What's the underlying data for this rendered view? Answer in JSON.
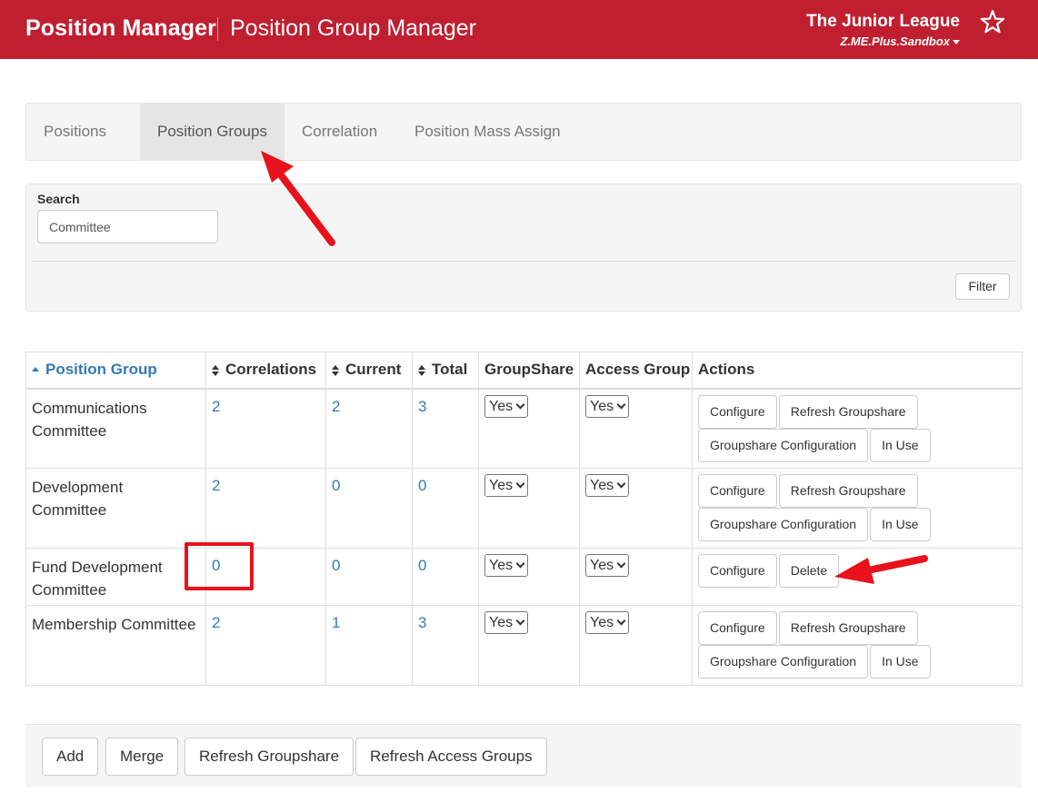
{
  "header": {
    "app_title": "Position Manager",
    "page_title": "Position Group Manager",
    "org_name": "The Junior League",
    "org_sub": "Z.ME.Plus.Sandbox",
    "brand_color": "#c01f30"
  },
  "tabs": [
    {
      "label": "Positions",
      "active": false
    },
    {
      "label": "Position Groups",
      "active": true
    },
    {
      "label": "Correlation",
      "active": false
    },
    {
      "label": "Position Mass Assign",
      "active": false
    }
  ],
  "search": {
    "label": "Search",
    "value": "Committee",
    "filter_label": "Filter"
  },
  "table": {
    "columns": [
      "Position Group",
      "Correlations",
      "Current",
      "Total",
      "GroupShare",
      "Access Group",
      "Actions"
    ],
    "rows": [
      {
        "name": "Communications Committee",
        "correlations": "2",
        "current": "2",
        "total": "3",
        "groupshare": "Yes",
        "access_group": "Yes",
        "actions": [
          "Configure",
          "Refresh Groupshare",
          "Groupshare Configuration",
          "In Use"
        ]
      },
      {
        "name": "Development Committee",
        "correlations": "2",
        "current": "0",
        "total": "0",
        "groupshare": "Yes",
        "access_group": "Yes",
        "actions": [
          "Configure",
          "Refresh Groupshare",
          "Groupshare Configuration",
          "In Use"
        ]
      },
      {
        "name": "Fund Development Committee",
        "correlations": "0",
        "current": "0",
        "total": "0",
        "groupshare": "Yes",
        "access_group": "Yes",
        "actions": [
          "Configure",
          "Delete"
        ]
      },
      {
        "name": "Membership Committee",
        "correlations": "2",
        "current": "1",
        "total": "3",
        "groupshare": "Yes",
        "access_group": "Yes",
        "actions": [
          "Configure",
          "Refresh Groupshare",
          "Groupshare Configuration",
          "In Use"
        ]
      }
    ]
  },
  "footer": {
    "buttons": [
      "Add",
      "Merge",
      "Refresh Groupshare",
      "Refresh Access Groups"
    ]
  },
  "annotations": {
    "color": "#e8121c"
  }
}
